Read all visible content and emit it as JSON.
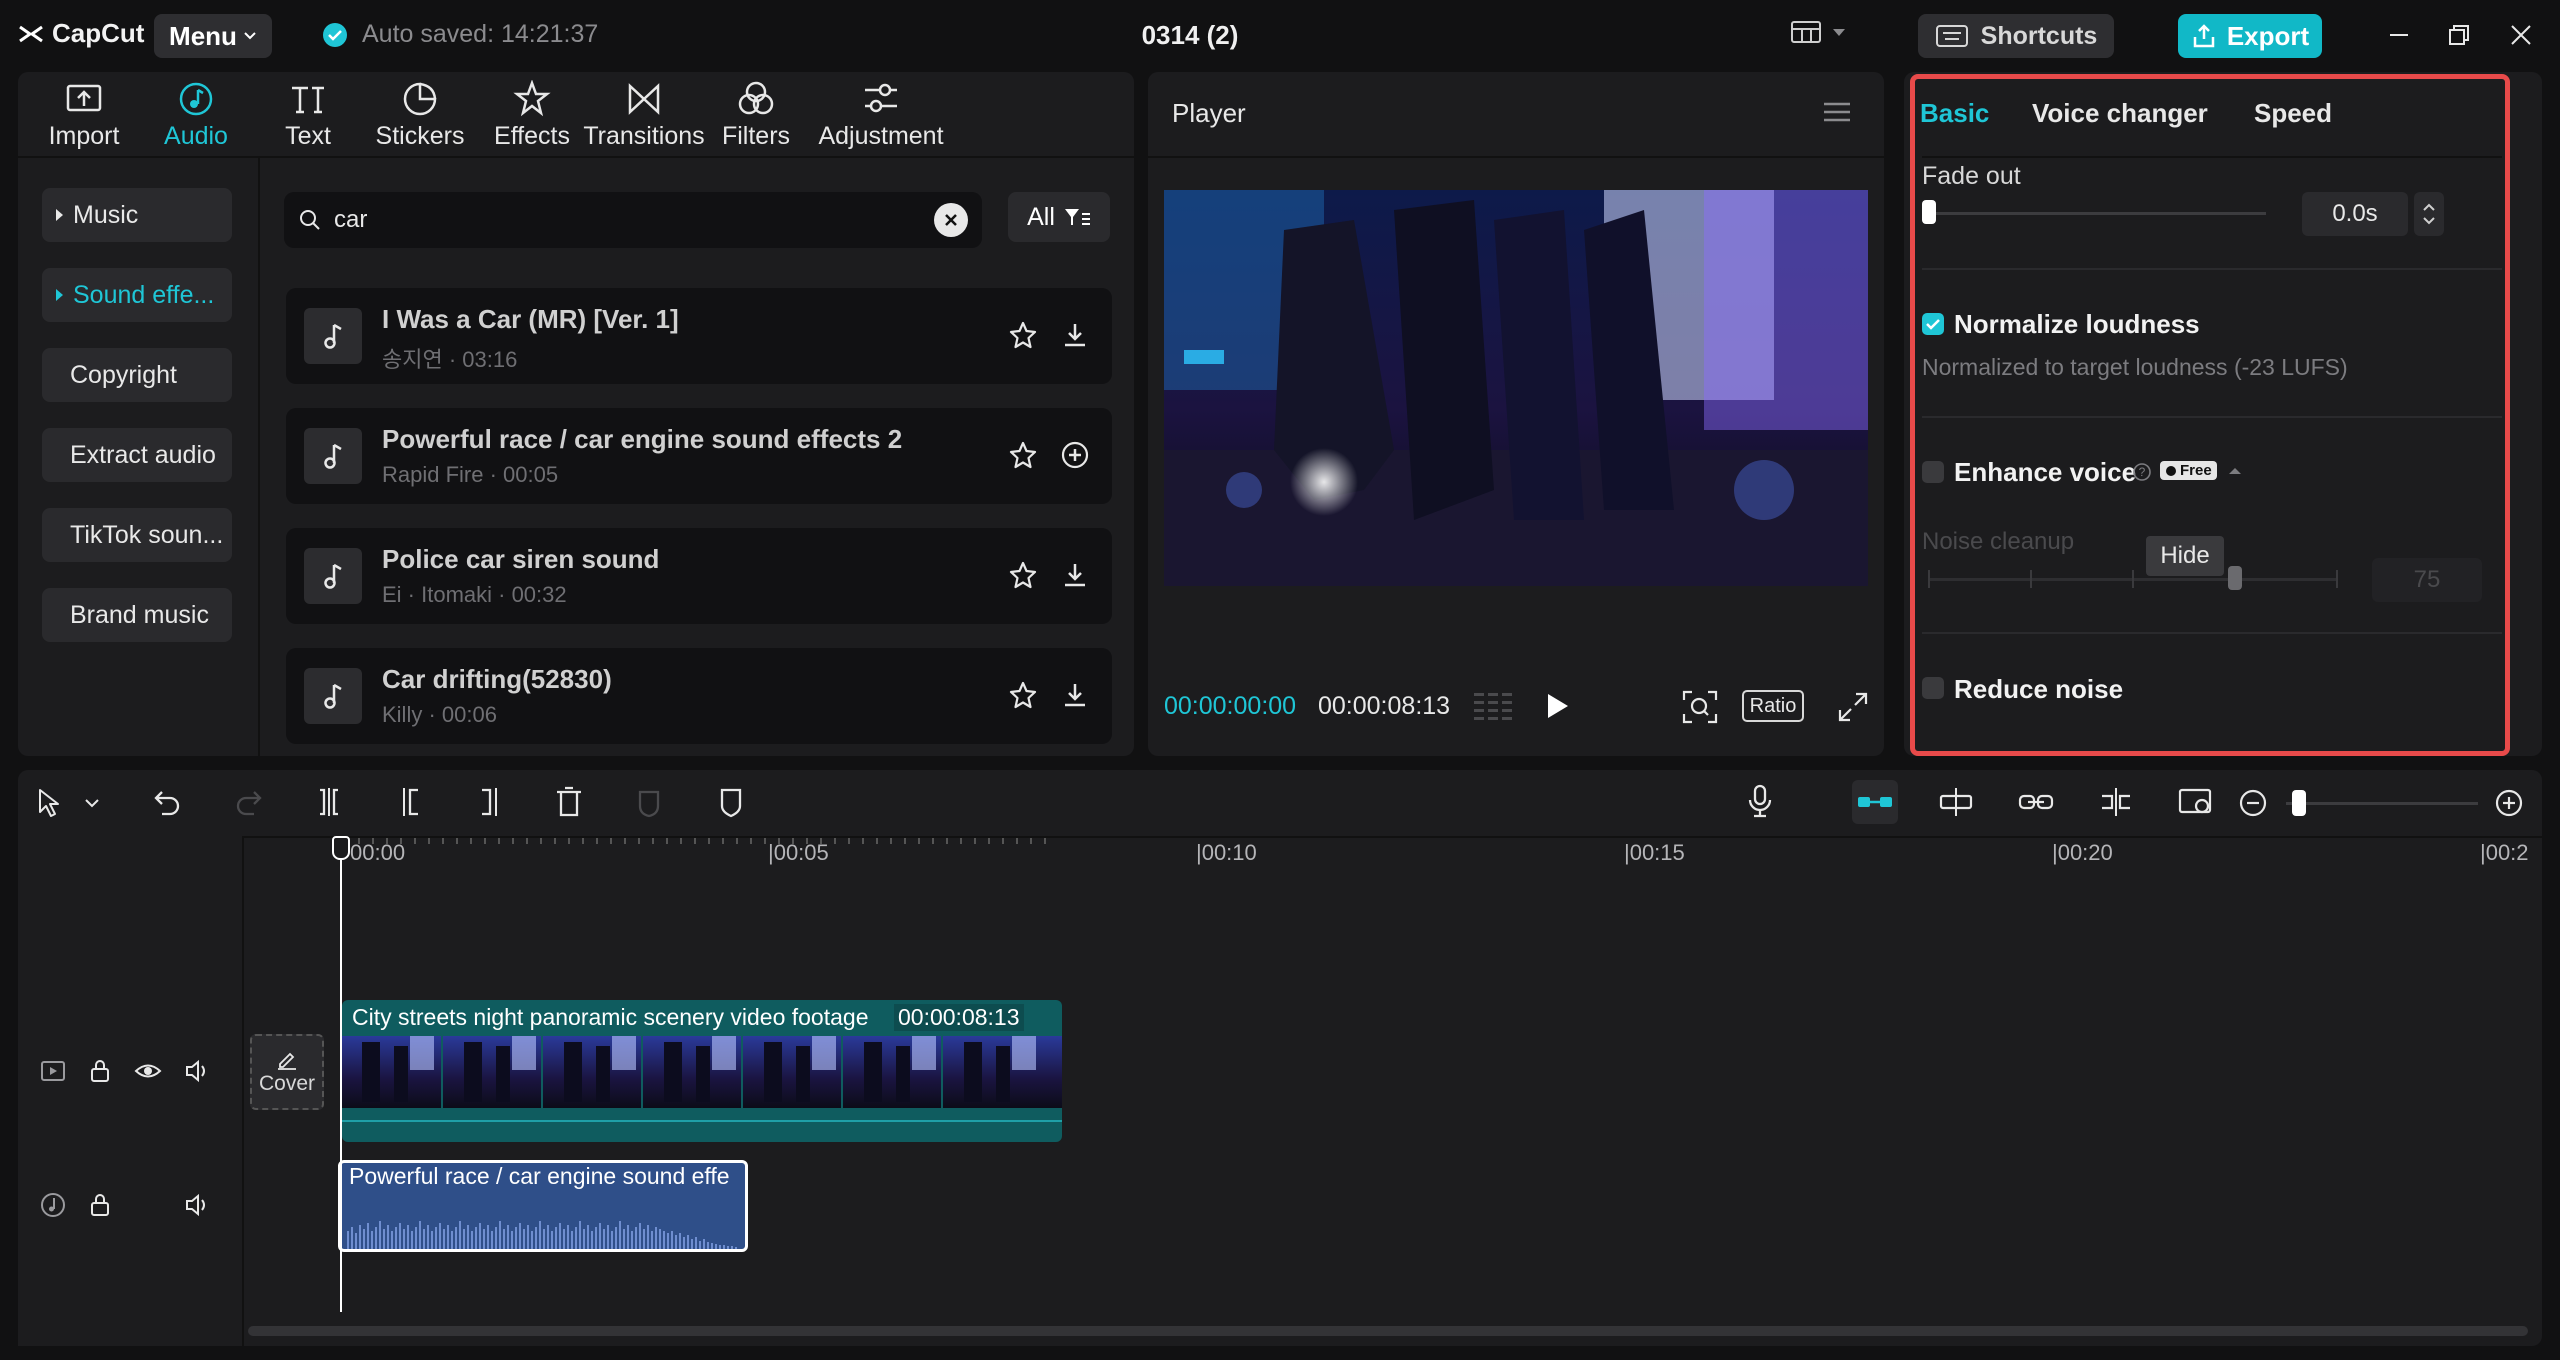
{
  "app": {
    "brand": "CapCut",
    "menu_label": "Menu",
    "autosave_text": "Auto saved: 14:21:37",
    "project_title": "0314 (2)",
    "shortcuts_label": "Shortcuts",
    "export_label": "Export"
  },
  "tabs": [
    {
      "label": "Import",
      "icon": "import-icon"
    },
    {
      "label": "Audio",
      "icon": "audio-icon",
      "active": true
    },
    {
      "label": "Text",
      "icon": "text-icon"
    },
    {
      "label": "Stickers",
      "icon": "stickers-icon"
    },
    {
      "label": "Effects",
      "icon": "effects-icon"
    },
    {
      "label": "Transitions",
      "icon": "transitions-icon"
    },
    {
      "label": "Filters",
      "icon": "filters-icon"
    },
    {
      "label": "Adjustment",
      "icon": "adjustment-icon"
    }
  ],
  "sidebar": {
    "items": [
      {
        "label": "Music"
      },
      {
        "label": "Sound effe..."
      },
      {
        "label": "Copyright"
      },
      {
        "label": "Extract audio"
      },
      {
        "label": "TikTok soun..."
      },
      {
        "label": "Brand music"
      }
    ]
  },
  "search": {
    "value": "car",
    "filter_label": "All"
  },
  "audio_list": [
    {
      "title": "I Was a Car (MR) [Ver. 1]",
      "subtitle": "송지연 · 03:16",
      "action": "download"
    },
    {
      "title": "Powerful race / car engine sound effects 2",
      "subtitle": "Rapid Fire · 00:05",
      "action": "add"
    },
    {
      "title": "Police car siren sound",
      "subtitle": "Ei · Itomaki · 00:32",
      "action": "download"
    },
    {
      "title": "Car drifting(52830)",
      "subtitle": "Killy · 00:06",
      "action": "download"
    }
  ],
  "player": {
    "title": "Player",
    "current_time": "00:00:00:00",
    "duration": "00:00:08:13",
    "ratio_label": "Ratio"
  },
  "right_panel": {
    "tabs": [
      "Basic",
      "Voice changer",
      "Speed"
    ],
    "fade_out_label": "Fade out",
    "fade_out_value": "0.0s",
    "normalize_label": "Normalize loudness",
    "normalize_desc": "Normalized to target loudness (-23 LUFS)",
    "enhance_label": "Enhance voice",
    "free_badge": "Free",
    "noise_cleanup_label": "Noise cleanup",
    "noise_cleanup_value": "75",
    "tooltip": "Hide",
    "reduce_noise_label": "Reduce noise"
  },
  "timeline": {
    "ruler": [
      "00:00",
      "|00:05",
      "|00:10",
      "|00:15",
      "|00:20",
      "|00:2"
    ],
    "video_clip_title": "City streets night panoramic scenery video footage",
    "video_clip_duration": "00:00:08:13",
    "audio_clip_title": "Powerful race / car engine sound effe",
    "cover_label": "Cover"
  },
  "colors": {
    "accent": "#1fc6d6",
    "highlight_border": "#e84a4a",
    "export_button": "#11b8c7",
    "video_clip": "#0f5c5f",
    "audio_clip": "#2f4f89"
  }
}
